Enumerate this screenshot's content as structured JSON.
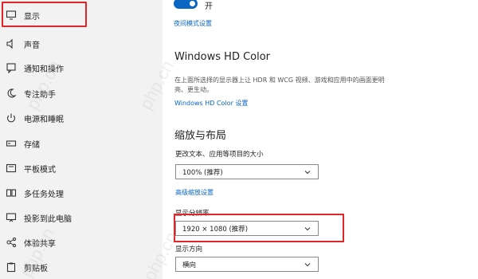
{
  "sidebar": {
    "items": [
      {
        "label": "显示",
        "icon": "monitor-icon"
      },
      {
        "label": "声音",
        "icon": "speaker-icon"
      },
      {
        "label": "通知和操作",
        "icon": "notification-icon"
      },
      {
        "label": "专注助手",
        "icon": "moon-icon"
      },
      {
        "label": "电源和睡眠",
        "icon": "power-icon"
      },
      {
        "label": "存储",
        "icon": "storage-icon"
      },
      {
        "label": "平板模式",
        "icon": "tablet-icon"
      },
      {
        "label": "多任务处理",
        "icon": "multitask-icon"
      },
      {
        "label": "投影到此电脑",
        "icon": "project-icon"
      },
      {
        "label": "体验共享",
        "icon": "share-icon"
      },
      {
        "label": "剪贴板",
        "icon": "clipboard-icon"
      }
    ]
  },
  "main": {
    "toggle_label": "开",
    "night_mode_link": "夜间模式设置",
    "hd_title": "Windows HD Color",
    "hd_desc": "在上面所选择的显示器上让 HDR 和 WCG 视频、游戏和应用中的画面更明亮、更生动。",
    "hd_link": "Windows HD Color 设置",
    "scale_title": "缩放与布局",
    "scale_label": "更改文本、应用等项目的大小",
    "scale_value": "100% (推荐)",
    "advanced_scale_link": "高级缩放设置",
    "resolution_label": "显示分辨率",
    "resolution_value": "1920 × 1080 (推荐)",
    "orientation_label": "显示方向",
    "orientation_value": "横向"
  },
  "watermark": "php.cn",
  "colors": {
    "accent": "#0a66c2",
    "highlight": "#e0262b",
    "sidebar_bg": "#f2f2f2"
  }
}
